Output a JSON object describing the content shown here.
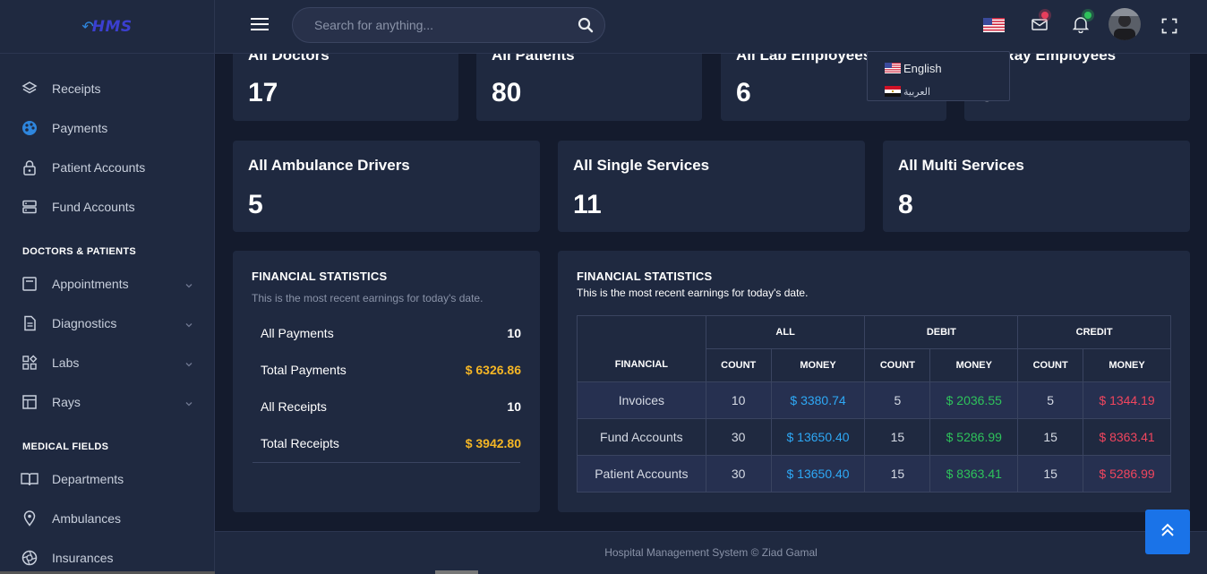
{
  "brand": {
    "logo_text": "HMS"
  },
  "search": {
    "placeholder": "Search for anything..."
  },
  "sidebar": {
    "items": [
      {
        "label": "Receipts",
        "icon": "layers-icon"
      },
      {
        "label": "Payments",
        "icon": "palette-icon"
      },
      {
        "label": "Patient Accounts",
        "icon": "lock-icon"
      },
      {
        "label": "Fund Accounts",
        "icon": "server-icon"
      }
    ],
    "section_doctors": "DOCTORS & PATIENTS",
    "doctor_items": [
      {
        "label": "Appointments",
        "icon": "calendar-icon"
      },
      {
        "label": "Diagnostics",
        "icon": "document-icon"
      },
      {
        "label": "Labs",
        "icon": "grid-icon"
      },
      {
        "label": "Rays",
        "icon": "table-icon"
      }
    ],
    "section_medical": "MEDICAL FIELDS",
    "medical_items": [
      {
        "label": "Departments",
        "icon": "book-icon"
      },
      {
        "label": "Ambulances",
        "icon": "location-pin-icon"
      },
      {
        "label": "Insurances",
        "icon": "aperture-icon"
      }
    ]
  },
  "language_menu": {
    "items": [
      {
        "label": "English",
        "flag": "us-flag-icon"
      },
      {
        "label": "العربية",
        "flag": "egypt-flag-icon"
      }
    ]
  },
  "stats_top": [
    {
      "title": "All Doctors",
      "value": "17"
    },
    {
      "title": "All Patients",
      "value": "80"
    },
    {
      "title": "All Lab Employees",
      "value": "6"
    },
    {
      "title": "All Ray Employees",
      "value": "5"
    }
  ],
  "stats_mid": [
    {
      "title": "All Ambulance Drivers",
      "value": "5"
    },
    {
      "title": "All Single Services",
      "value": "11"
    },
    {
      "title": "All Multi Services",
      "value": "8"
    }
  ],
  "financial_left": {
    "title": "FINANCIAL STATISTICS",
    "subtitle": "This is the most recent earnings for today's date.",
    "rows": [
      {
        "label": "All Payments",
        "value": "10"
      },
      {
        "label": "Total Payments",
        "value": "$ 6326.86"
      },
      {
        "label": "All Receipts",
        "value": "10"
      },
      {
        "label": "Total Receipts",
        "value": "$ 3942.80"
      }
    ]
  },
  "financial_right": {
    "title": "FINANCIAL STATISTICS",
    "subtitle": "This is the most recent earnings for today's date.",
    "headers": {
      "financial": "FINANCIAL",
      "all": "ALL",
      "debit": "DEBIT",
      "credit": "CREDIT",
      "count": "COUNT",
      "money": "MONEY"
    },
    "rows": [
      {
        "name": "Invoices",
        "all_count": "10",
        "all_money": "$ 3380.74",
        "debit_count": "5",
        "debit_money": "$ 2036.55",
        "credit_count": "5",
        "credit_money": "$ 1344.19"
      },
      {
        "name": "Fund Accounts",
        "all_count": "30",
        "all_money": "$ 13650.40",
        "debit_count": "15",
        "debit_money": "$ 5286.99",
        "credit_count": "15",
        "credit_money": "$ 8363.41"
      },
      {
        "name": "Patient Accounts",
        "all_count": "30",
        "all_money": "$ 13650.40",
        "debit_count": "15",
        "debit_money": "$ 8363.41",
        "credit_count": "15",
        "credit_money": "$ 5286.99"
      }
    ]
  },
  "footer": {
    "text": "Hospital Management System © Ziad Gamal"
  },
  "colors": {
    "background": "#141b2d",
    "panel": "#1f2940",
    "accent_blue": "#1a73e8",
    "money_blue": "#2ea8f5",
    "money_green": "#2ec25b",
    "money_red": "#f0455e",
    "yellow": "#f5b625"
  }
}
